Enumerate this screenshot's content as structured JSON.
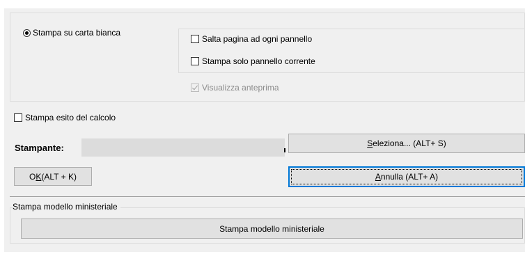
{
  "print_options": {
    "plain_paper_radio": {
      "label": "Stampa su carta bianca",
      "checked": true
    },
    "skip_page_checkbox": {
      "label": "Salta pagina ad ogni pannello",
      "checked": false
    },
    "current_panel_checkbox": {
      "label": "Stampa solo pannello corrente",
      "checked": false
    },
    "preview_checkbox": {
      "label": "Visualizza anteprima",
      "checked": true,
      "enabled": false
    }
  },
  "calc_result_checkbox": {
    "label": "Stampa esito del calcolo",
    "checked": false
  },
  "printer": {
    "label": "Stampante:",
    "select_button": {
      "mnemonic": "S",
      "rest": "eleziona... (ALT+ S)"
    }
  },
  "ok_button": {
    "before": "O",
    "mnemonic": "K",
    "after": " (ALT + K)"
  },
  "cancel_button": {
    "mnemonic": "A",
    "rest": "nnulla (ALT+ A)"
  },
  "ministerial_section": {
    "title": "Stampa modello ministeriale",
    "button_label": "Stampa modello ministeriale"
  }
}
